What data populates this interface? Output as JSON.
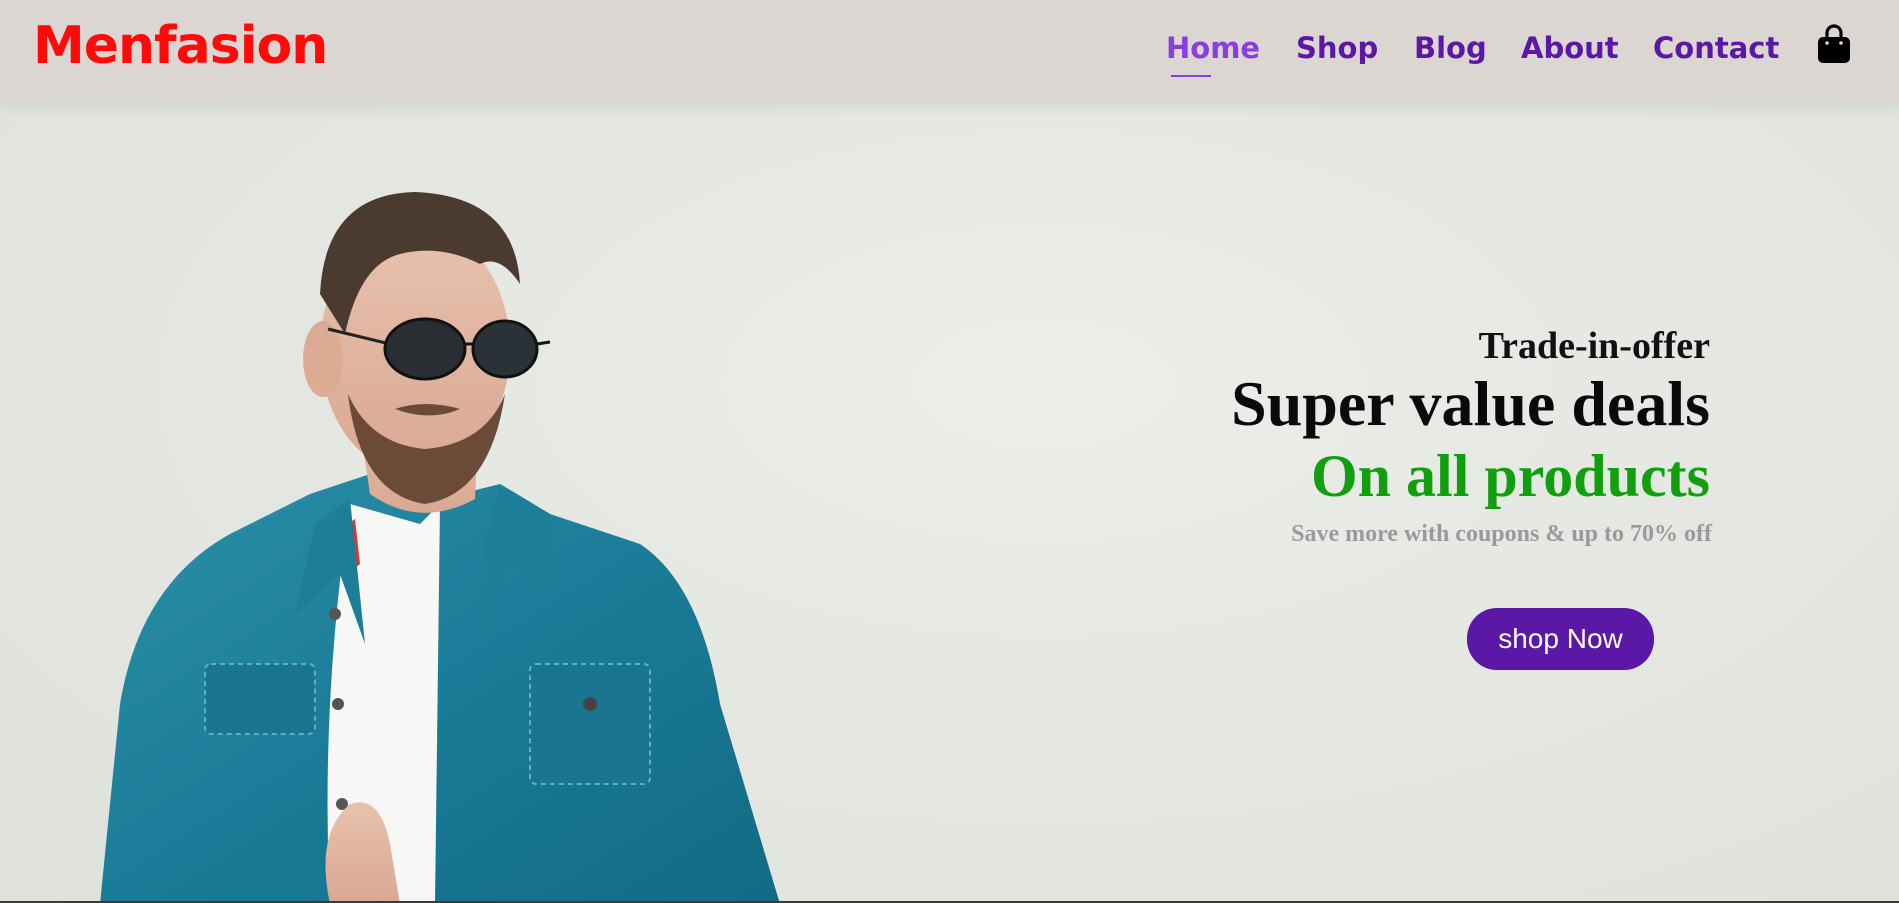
{
  "colors": {
    "brand": "#ff0a0a",
    "nav_text": "#5b17a6",
    "nav_active": "#8a3ee0",
    "accent_green": "#119e0f",
    "button_bg": "#5b17a6",
    "header_bg": "#dbd6d1"
  },
  "header": {
    "logo": "Menfasion",
    "nav": [
      {
        "label": "Home",
        "active": true
      },
      {
        "label": "Shop",
        "active": false
      },
      {
        "label": "Blog",
        "active": false
      },
      {
        "label": "About",
        "active": false
      },
      {
        "label": "Contact",
        "active": false
      }
    ],
    "cart_icon": "shopping-bag-icon"
  },
  "hero": {
    "eyebrow": "Trade-in-offer",
    "headline": "Super value deals",
    "headline_accent": "On all products",
    "subtext": "Save more with coupons & up to 70% off",
    "button_label": "shop Now"
  }
}
